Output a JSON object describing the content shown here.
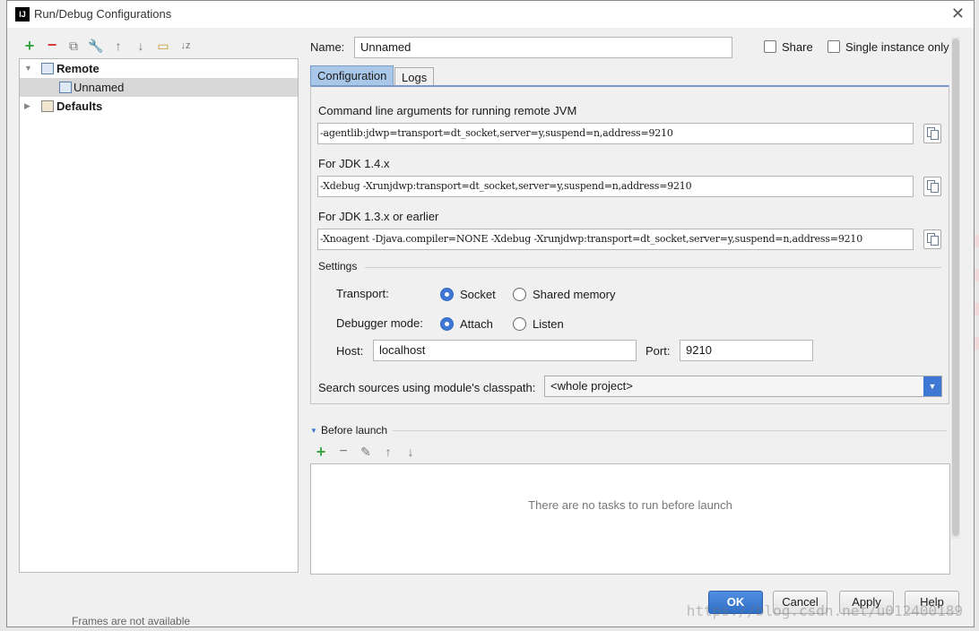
{
  "window": {
    "title": "Run/Debug Configurations",
    "logo_text": "IJ"
  },
  "toolbar": {
    "icons": [
      "add-icon",
      "remove-icon",
      "copy-icon",
      "wrench-icon",
      "move-up-icon",
      "move-down-icon",
      "folder-icon",
      "sort-icon"
    ]
  },
  "tree": {
    "items": [
      {
        "label": "Remote",
        "expanded": true
      },
      {
        "label": "Unnamed",
        "selected": true
      },
      {
        "label": "Defaults",
        "expanded": false
      }
    ]
  },
  "form": {
    "name_label": "Name:",
    "name_value": "Unnamed",
    "share_label": "Share",
    "single_instance_label": "Single instance only"
  },
  "tabs": [
    {
      "label": "Configuration",
      "active": true
    },
    {
      "label": "Logs",
      "active": false
    }
  ],
  "config": {
    "cmd_label": "Command line arguments for running remote JVM",
    "cmd_value": "-agentlib:jdwp=transport=dt_socket,server=y,suspend=n,address=9210",
    "jdk14_label": "For JDK 1.4.x",
    "jdk14_value": "-Xdebug -Xrunjdwp:transport=dt_socket,server=y,suspend=n,address=9210",
    "jdk13_label": "For JDK 1.3.x or earlier",
    "jdk13_value": "-Xnoagent -Djava.compiler=NONE -Xdebug -Xrunjdwp:transport=dt_socket,server=y,suspend=n,address=9210",
    "settings_label": "Settings",
    "transport_label": "Transport:",
    "transport_options": [
      {
        "label": "Socket",
        "selected": true
      },
      {
        "label": "Shared memory",
        "selected": false
      }
    ],
    "debugger_mode_label": "Debugger mode:",
    "debugger_mode_options": [
      {
        "label": "Attach",
        "selected": true
      },
      {
        "label": "Listen",
        "selected": false
      }
    ],
    "host_label": "Host:",
    "host_value": "localhost",
    "port_label": "Port:",
    "port_value": "9210",
    "classpath_label": "Search sources using module's classpath:",
    "classpath_value": "<whole project>"
  },
  "before_launch": {
    "label": "Before launch",
    "icons": [
      "add-icon",
      "remove-icon",
      "edit-icon",
      "move-up-icon",
      "move-down-icon"
    ],
    "empty_message": "There are no tasks to run before launch"
  },
  "buttons": {
    "ok": "OK",
    "cancel": "Cancel",
    "apply": "Apply",
    "help": "Help"
  },
  "background": {
    "status_text": "Frames are not available",
    "watermark": "https://blog.csdn.net/u012400189"
  },
  "colors": {
    "accent": "#3f78d4",
    "tab_active": "#a9c7e8",
    "add_green": "#3aa544",
    "remove_red": "#d23b3b"
  }
}
